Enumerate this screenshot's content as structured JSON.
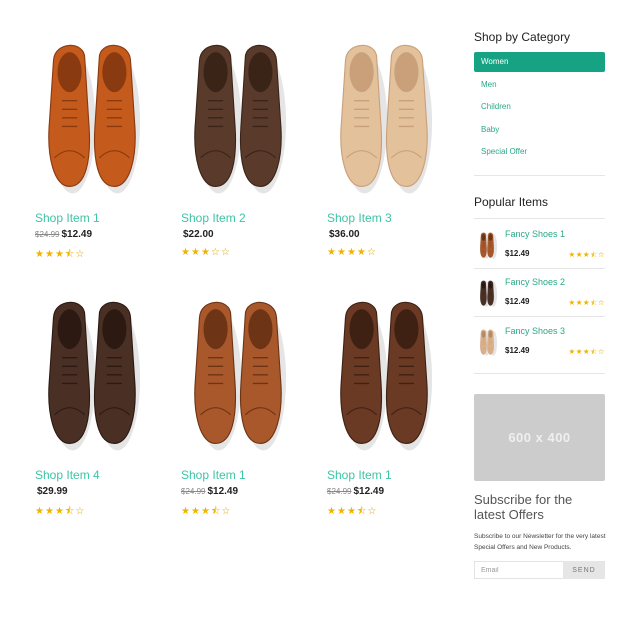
{
  "products": [
    {
      "name": "Shop Item 1",
      "old_price": "$24.99",
      "price": "$12.49",
      "rating": 3.5,
      "stars_text": "★★★⯪☆",
      "shoe_color": "#c45a1c",
      "shoe_dark": "#8a3a10"
    },
    {
      "name": "Shop Item 2",
      "old_price": "",
      "price": "$22.00",
      "rating": 3,
      "stars_text": "★★★☆☆",
      "shoe_color": "#5a3b2b",
      "shoe_dark": "#3a2418"
    },
    {
      "name": "Shop Item 3",
      "old_price": "",
      "price": "$36.00",
      "rating": 4,
      "stars_text": "★★★★☆",
      "shoe_color": "#e3c19b",
      "shoe_dark": "#c9a07a"
    },
    {
      "name": "Shop Item 4",
      "old_price": "",
      "price": "$29.99",
      "rating": 3.5,
      "stars_text": "★★★⯪☆",
      "shoe_color": "#4a3024",
      "shoe_dark": "#2c1a12"
    },
    {
      "name": "Shop Item 1",
      "old_price": "$24.99",
      "price": "$12.49",
      "rating": 3.5,
      "stars_text": "★★★⯪☆",
      "shoe_color": "#a8582a",
      "shoe_dark": "#6e3416"
    },
    {
      "name": "Shop Item 1",
      "old_price": "$24.99",
      "price": "$12.49",
      "rating": 3.5,
      "stars_text": "★★★⯪☆",
      "shoe_color": "#6a3a24",
      "shoe_dark": "#3f2114"
    }
  ],
  "sidebar": {
    "category_title": "Shop by Category",
    "categories": [
      {
        "label": "Women",
        "active": true
      },
      {
        "label": "Men",
        "active": false
      },
      {
        "label": "Children",
        "active": false
      },
      {
        "label": "Baby",
        "active": false
      },
      {
        "label": "Special Offer",
        "active": false
      }
    ],
    "popular_title": "Popular Items",
    "popular": [
      {
        "name": "Fancy Shoes 1",
        "price": "$12.49",
        "stars_text": "★★★⯪☆",
        "shoe_color": "#a8582a",
        "shoe_dark": "#6e3416"
      },
      {
        "name": "Fancy Shoes 2",
        "price": "$12.49",
        "stars_text": "★★★⯪☆",
        "shoe_color": "#4a3024",
        "shoe_dark": "#2c1a12"
      },
      {
        "name": "Fancy Shoes 3",
        "price": "$12.49",
        "stars_text": "★★★⯪☆",
        "shoe_color": "#d9b08a",
        "shoe_dark": "#b88a62"
      }
    ],
    "ad_label": "600 x 400",
    "subscribe": {
      "title": "Subscribe for the latest Offers",
      "text": "Subscribe to our Newsletter for the very latest Special Offers and New Products.",
      "email_placeholder": "Email",
      "send_label": "SEND"
    }
  },
  "colors": {
    "accent": "#16a383",
    "link": "#3ec4a5",
    "star": "#f0b400",
    "ad_bg": "#cccccc"
  }
}
